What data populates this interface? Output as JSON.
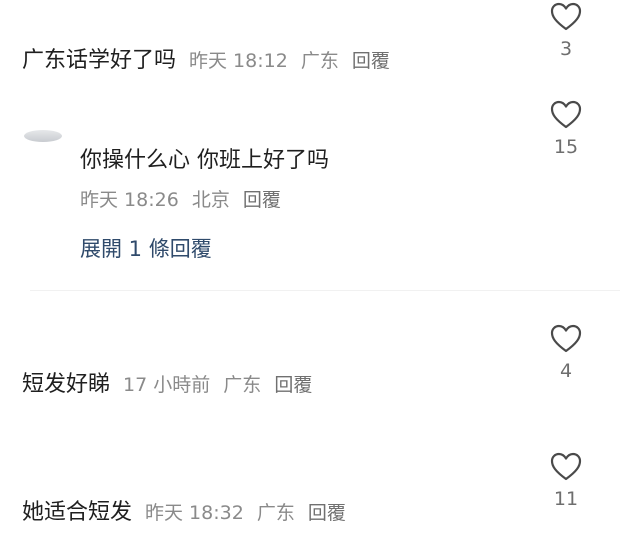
{
  "comments": [
    {
      "text": "广东话学好了吗",
      "time": "昨天 18:12",
      "location": "广东",
      "reply": "回覆",
      "likes": "3"
    },
    {
      "text": "你操什么心 你班上好了吗",
      "time": "昨天 18:26",
      "location": "北京",
      "reply": "回覆",
      "likes": "15",
      "expand_label": "展開 1 條回覆"
    },
    {
      "text": "短发好睇",
      "time": "17 小時前",
      "location": "广东",
      "reply": "回覆",
      "likes": "4"
    },
    {
      "text": "她适合短发",
      "time": "昨天 18:32",
      "location": "广东",
      "reply": "回覆",
      "likes": "11"
    }
  ],
  "icons": {
    "like": "heart-outline-icon"
  },
  "colors": {
    "text": "#1f1f1f",
    "meta": "#8a8a8a",
    "expand": "#2f4a6b"
  }
}
